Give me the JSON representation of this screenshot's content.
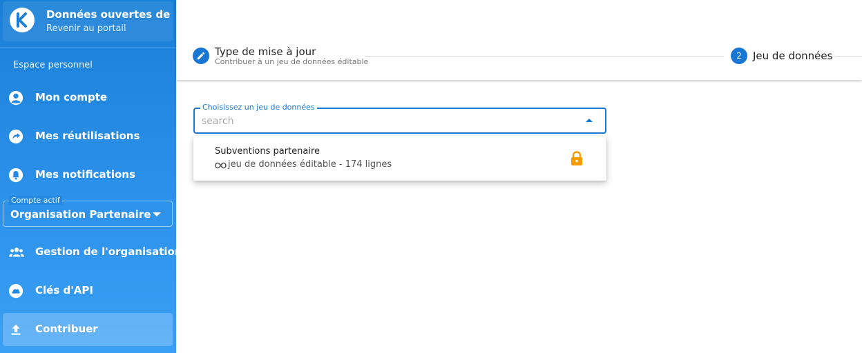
{
  "portal": {
    "title": "Données ouvertes de r...",
    "subtitle": "Revenir au portail",
    "logo_icon": "k-logo-icon"
  },
  "sidebar": {
    "section_label": "Espace personnel",
    "items": [
      {
        "label": "Mon compte",
        "icon": "account-circle-icon"
      },
      {
        "label": "Mes réutilisations",
        "icon": "share-arrow-icon"
      },
      {
        "label": "Mes notifications",
        "icon": "bell-icon"
      }
    ],
    "account": {
      "legend": "Compte actif",
      "value": "Organisation Partenaire"
    },
    "org_items": [
      {
        "label": "Gestion de l'organisation",
        "icon": "group-icon"
      },
      {
        "label": "Clés d'API",
        "icon": "cloud-icon"
      },
      {
        "label": "Contribuer",
        "icon": "upload-icon",
        "active": true
      }
    ],
    "colors": {
      "gradient_top": "#1a7fd6",
      "gradient_bottom": "#3aa0f5"
    }
  },
  "stepper": {
    "step1": {
      "title": "Type de mise à jour",
      "subtitle": "Contribuer à un jeu de données éditable",
      "icon": "pencil-icon"
    },
    "step2": {
      "number": "2",
      "title": "Jeu de données"
    }
  },
  "dataset_select": {
    "legend": "Choisissez un jeu de données",
    "placeholder": "search",
    "value": ""
  },
  "dropdown": {
    "items": [
      {
        "title": "Subventions partenaire",
        "subtitle": "jeu de données éditable - 174 lignes",
        "subtitle_icon": "infinity-icon",
        "status_icon": "lock-icon"
      }
    ]
  },
  "colors": {
    "primary": "#1976d2",
    "lock": "#f59c00"
  }
}
